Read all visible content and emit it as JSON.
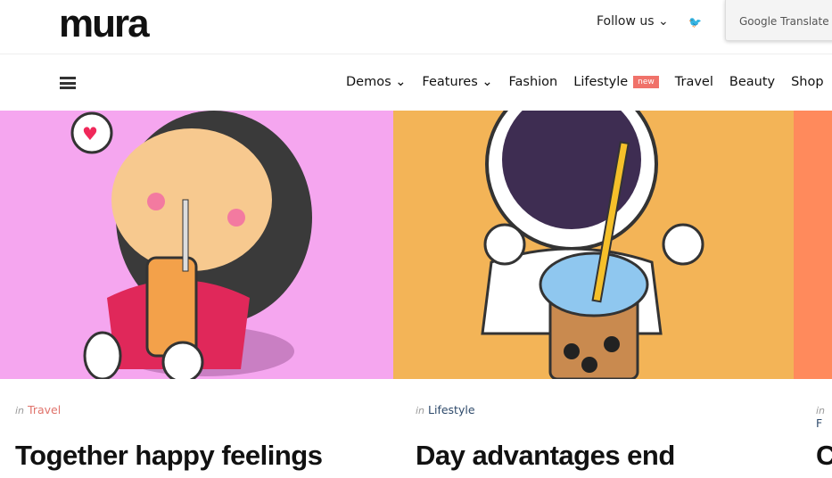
{
  "header": {
    "logo": "mura",
    "follow": "Follow us ⌄",
    "twitter_icon": "twitter-icon",
    "translate": "Google Translate"
  },
  "nav": {
    "items": [
      {
        "label": "Demos ⌄"
      },
      {
        "label": "Features ⌄"
      },
      {
        "label": "Fashion"
      },
      {
        "label": "Lifestyle",
        "badge": "new"
      },
      {
        "label": "Travel"
      },
      {
        "label": "Beauty"
      },
      {
        "label": "Shop"
      }
    ]
  },
  "cards": [
    {
      "in": "in",
      "category": "Travel",
      "category_color": "#e0736b",
      "title": "Together happy feelings",
      "bg": "#f5a6ef"
    },
    {
      "in": "in",
      "category": "Lifestyle",
      "category_color": "#2e4a6b",
      "title": "Day advantages end",
      "bg": "#f3b457"
    },
    {
      "in": "in",
      "category": "F",
      "category_color": "#2e4a6b",
      "title": "C",
      "bg": "#ff8a5c"
    }
  ]
}
